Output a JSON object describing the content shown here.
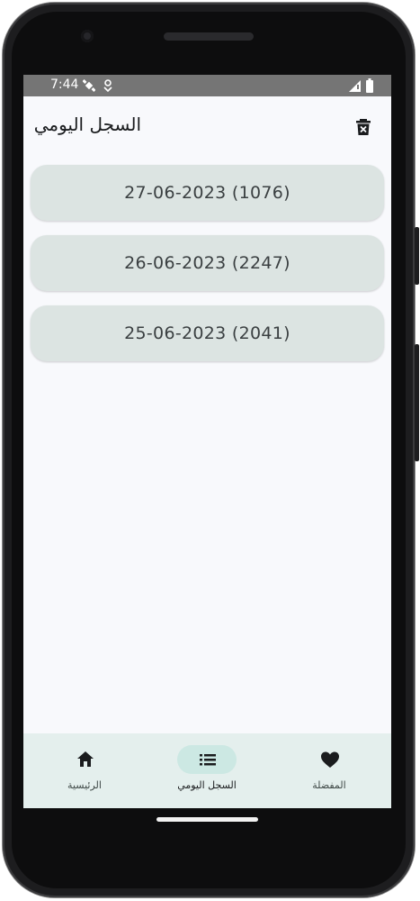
{
  "status_bar": {
    "time": "7:44"
  },
  "app_bar": {
    "title": "السجل اليومي",
    "trash_icon": "delete-forever-icon"
  },
  "history_items": [
    {
      "label": "27-06-2023 (1076)"
    },
    {
      "label": "26-06-2023 (2247)"
    },
    {
      "label": "25-06-2023 (2041)"
    }
  ],
  "bottom_nav": {
    "items": [
      {
        "label": "الرئيسية",
        "icon": "home-icon",
        "active": false
      },
      {
        "label": "السجل اليومي",
        "icon": "list-icon",
        "active": true
      },
      {
        "label": "المفضلة",
        "icon": "heart-icon",
        "active": false
      }
    ]
  },
  "colors": {
    "card": "#dce4e2",
    "nav_background": "#e4efed",
    "nav_active_pill": "#cce8e3",
    "background": "#f8f9fc"
  }
}
